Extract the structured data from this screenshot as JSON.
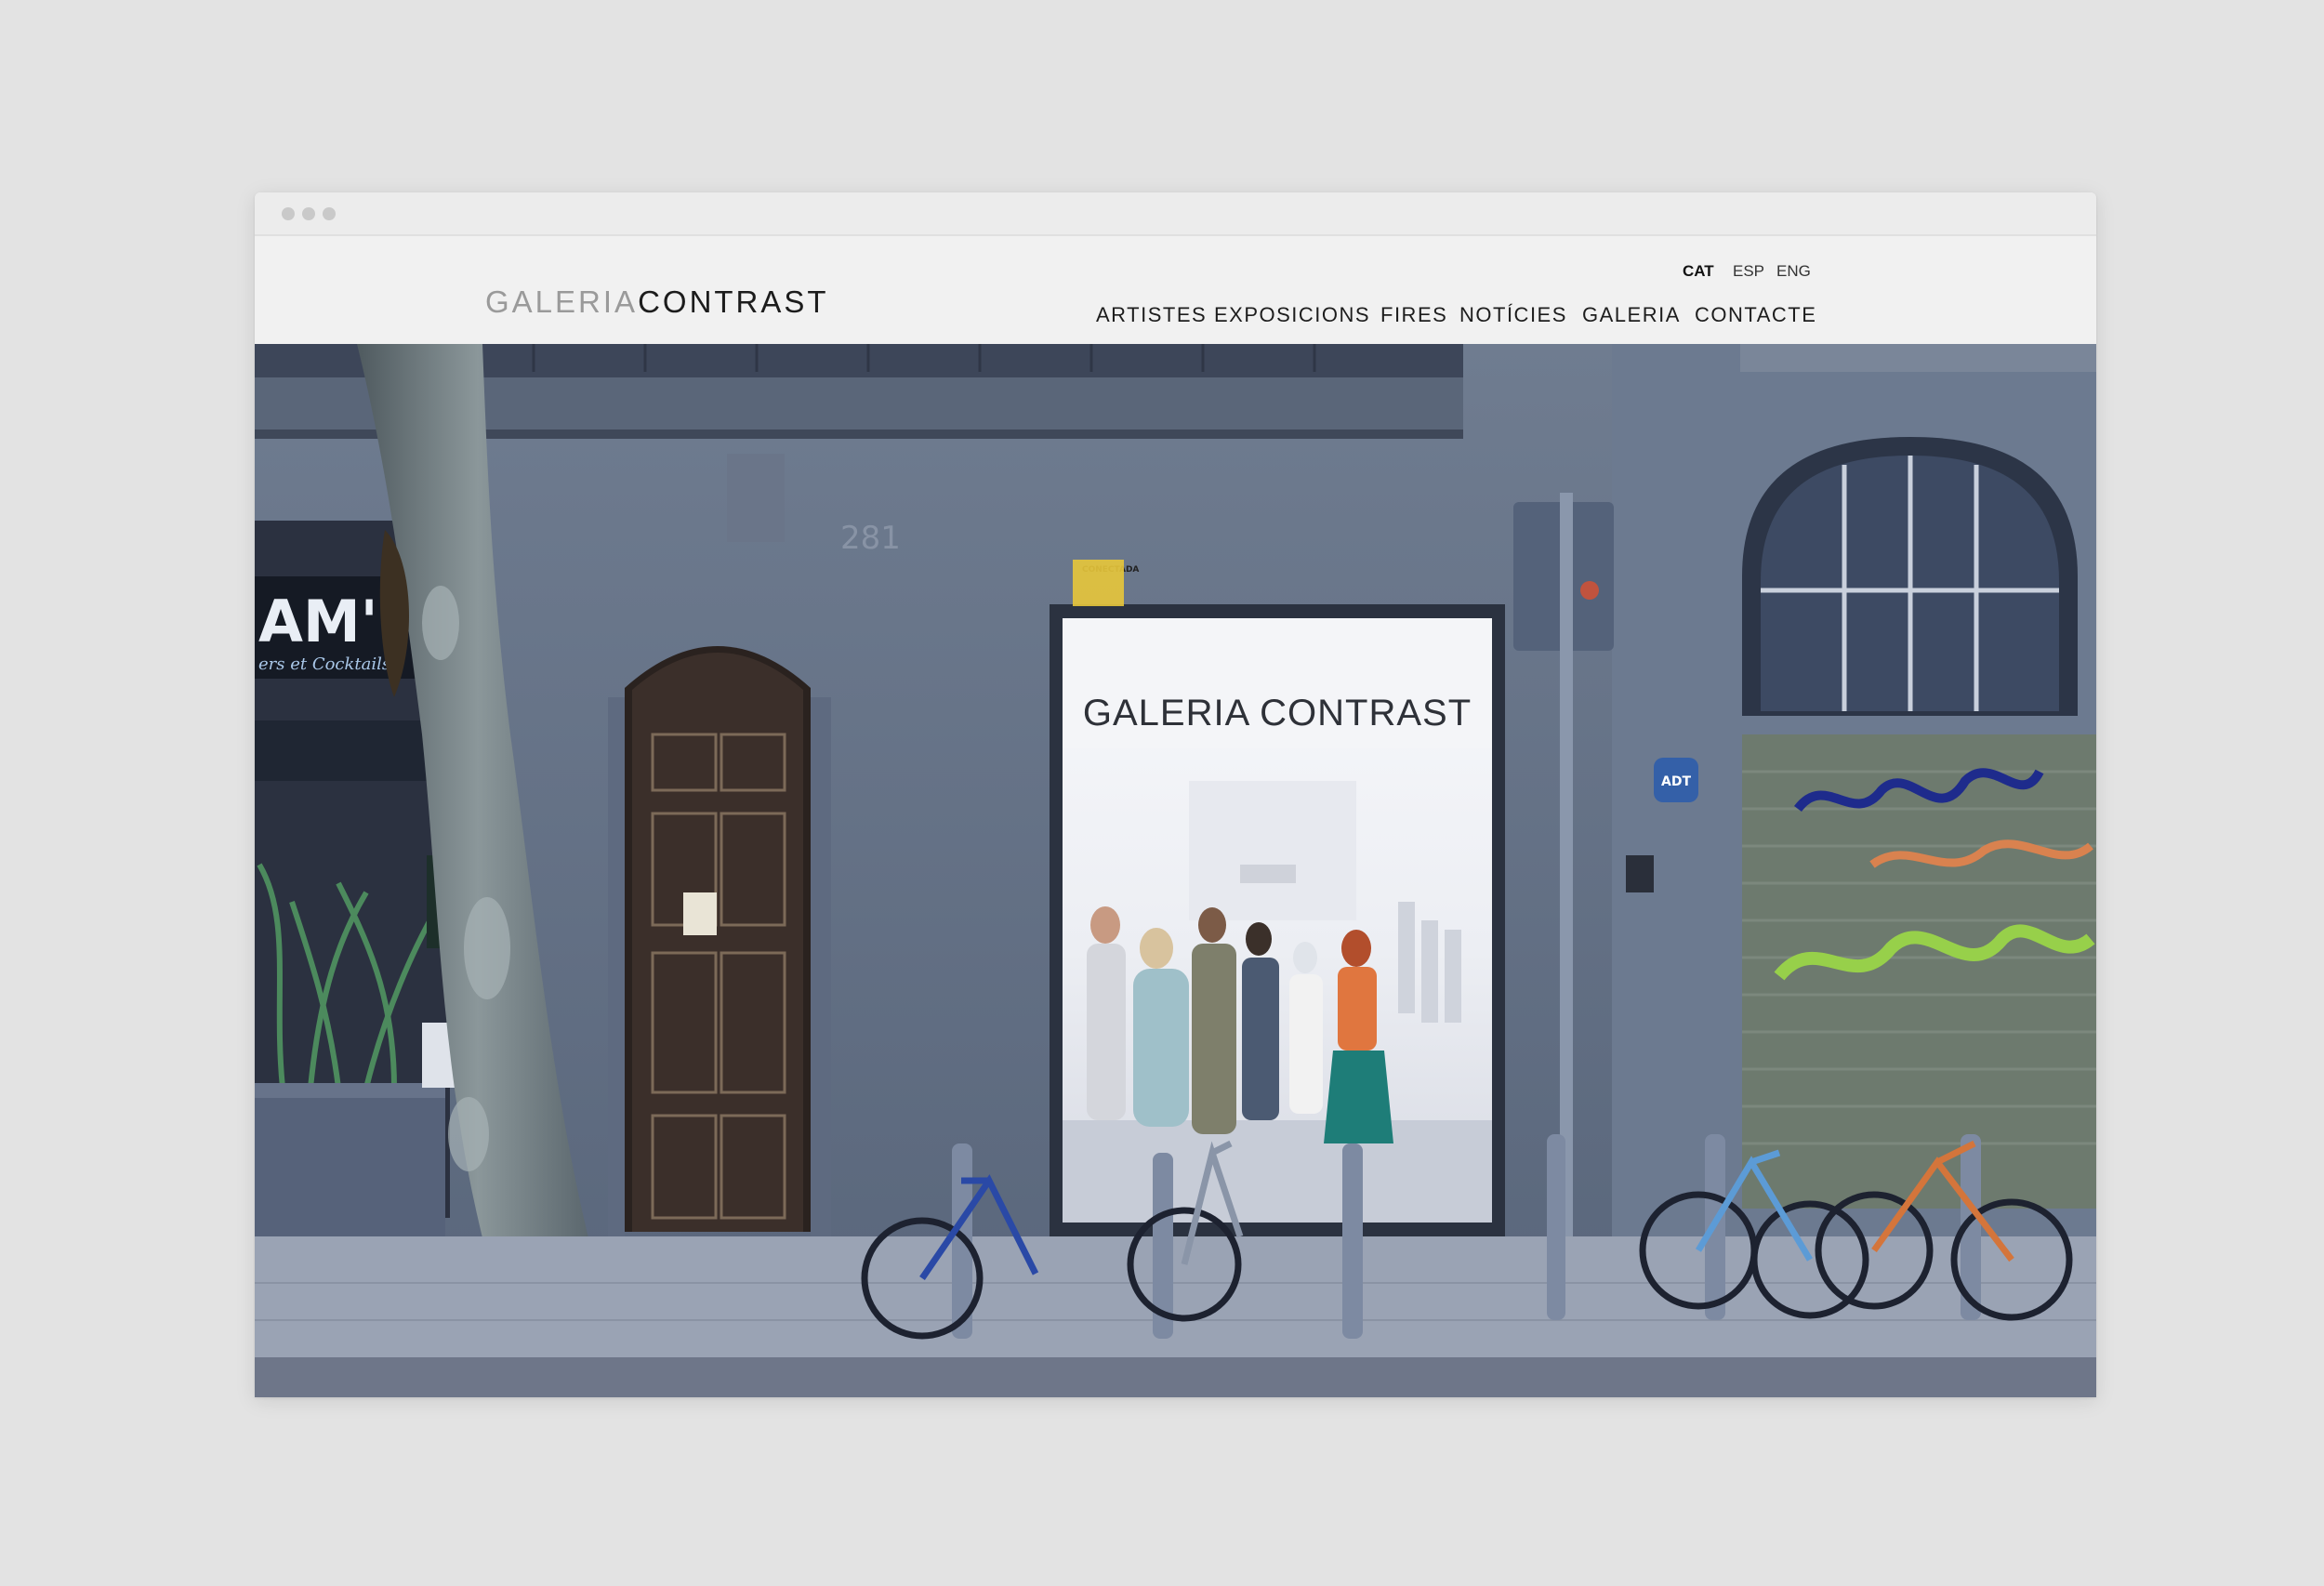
{
  "site": {
    "logo_light": "GALERIA",
    "logo_dark": "CONTRAST"
  },
  "languages": [
    "CAT",
    "ESP",
    "ENG"
  ],
  "active_language": "CAT",
  "nav": [
    "ARTISTES",
    "EXPOSICIONS",
    "FIRES",
    "NOTÍCIES",
    "GALERIA",
    "CONTACTE"
  ],
  "hero": {
    "storefront_sign": "GALERIA CONTRAST",
    "street_number": "281",
    "bar_sign": "AM'75",
    "bar_sign_sub": "ers et Cocktails",
    "alarm_label": "ADT",
    "window_sticker": "CONECTADA"
  },
  "colors": {
    "page_bg": "#e3e3e3",
    "header_bg": "#f1f1f1",
    "text_dark": "#1c1c1c",
    "logo_light": "#9a9a9a"
  }
}
